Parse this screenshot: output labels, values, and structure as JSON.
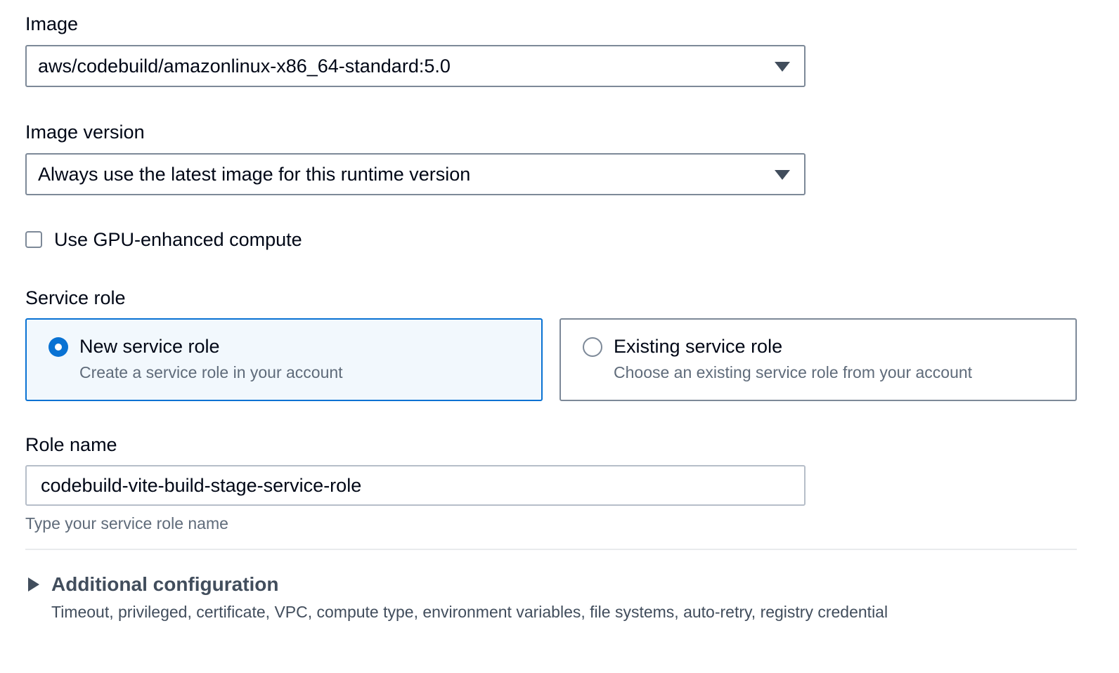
{
  "image": {
    "label": "Image",
    "value": "aws/codebuild/amazonlinux-x86_64-standard:5.0",
    "icon": "caret-down-icon"
  },
  "image_version": {
    "label": "Image version",
    "value": "Always use the latest image for this runtime version",
    "icon": "caret-down-icon"
  },
  "gpu": {
    "label": "Use GPU-enhanced compute",
    "checked": false
  },
  "service_role": {
    "label": "Service role",
    "options": [
      {
        "title": "New service role",
        "description": "Create a service role in your account",
        "selected": true
      },
      {
        "title": "Existing service role",
        "description": "Choose an existing service role from your account",
        "selected": false
      }
    ]
  },
  "role_name": {
    "label": "Role name",
    "value": "codebuild-vite-build-stage-service-role",
    "hint": "Type your service role name"
  },
  "additional_configuration": {
    "title": "Additional configuration",
    "description": "Timeout, privileged, certificate, VPC, compute type, environment variables, file systems, auto-retry, registry credential",
    "icon": "caret-right-icon",
    "expanded": false
  },
  "colors": {
    "accent": "#0972d3",
    "selected_tile_bg": "#f2f8fd",
    "border": "#7d8998",
    "secondary_text": "#5f6b7a"
  }
}
